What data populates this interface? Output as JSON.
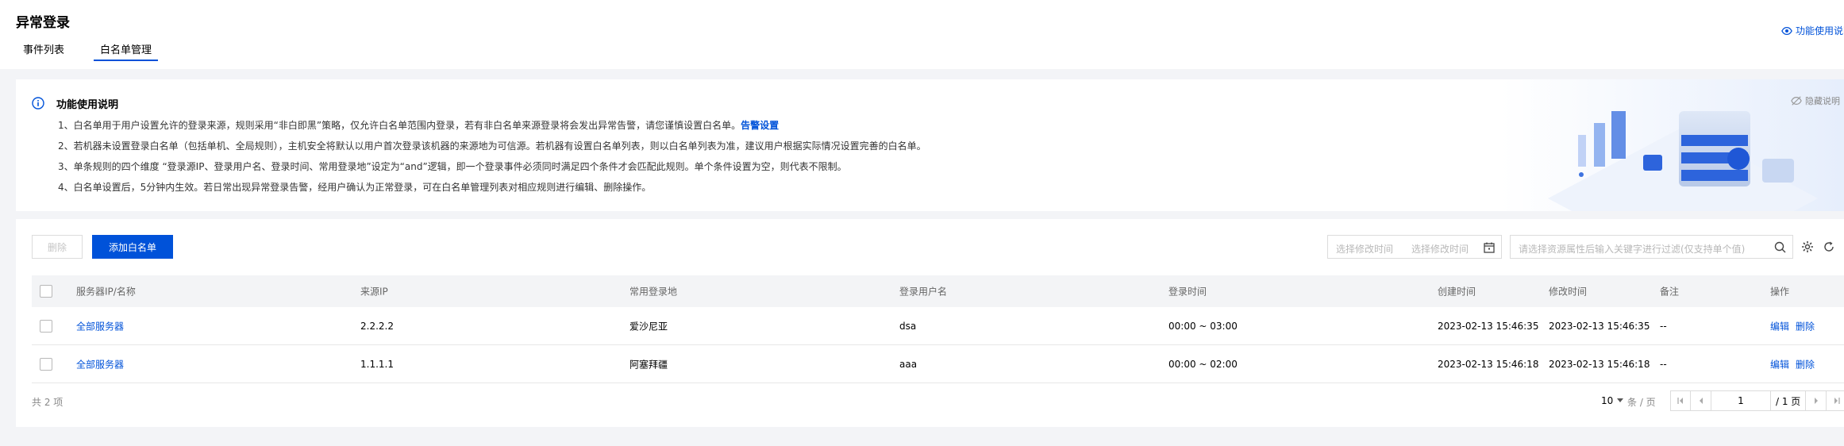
{
  "header": {
    "title": "异常登录",
    "tabs": [
      {
        "label": "事件列表",
        "active": false
      },
      {
        "label": "白名单管理",
        "active": true
      }
    ],
    "help_label": "功能使用说明"
  },
  "info": {
    "title": "功能使用说明",
    "lines": [
      "1、白名单用于用户设置允许的登录来源，规则采用“非白即黑”策略，仅允许白名单范围内登录，若有非白名单来源登录将会发出异常告警，请您谨慎设置白名单。",
      "2、若机器未设置登录白名单（包括单机、全局规则），主机安全将默认以用户首次登录该机器的来源地为可信源。若机器有设置白名单列表，则以白名单列表为准，建议用户根据实际情况设置完善的白名单。",
      "3、单条规则的四个维度 “登录源IP、登录用户名、登录时间、常用登录地”设定为“and”逻辑，即一个登录事件必须同时满足四个条件才会匹配此规则。单个条件设置为空，则代表不限制。",
      "4、白名单设置后，5分钟内生效。若日常出现异常登录告警，经用户确认为正常登录，可在白名单管理列表对相应规则进行编辑、删除操作。"
    ],
    "alert_link": "告警设置",
    "hide_label": "隐藏说明"
  },
  "toolbar": {
    "delete_label": "删除",
    "add_label": "添加白名单",
    "date_start_placeholder": "选择修改时间",
    "date_end_placeholder": "选择修改时间",
    "search_placeholder": "请选择资源属性后输入关键字进行过滤(仅支持单个值)"
  },
  "table": {
    "columns": [
      "服务器IP/名称",
      "来源IP",
      "常用登录地",
      "登录用户名",
      "登录时间",
      "创建时间",
      "修改时间",
      "备注",
      "操作"
    ],
    "rows": [
      {
        "server": "全部服务器",
        "source_ip": "2.2.2.2",
        "location": "爱沙尼亚",
        "username": "dsa",
        "login_time": "00:00 ~ 03:00",
        "created": "2023-02-13 15:46:35",
        "modified": "2023-02-13 15:46:35",
        "note": "--",
        "edit": "编辑",
        "delete": "删除"
      },
      {
        "server": "全部服务器",
        "source_ip": "1.1.1.1",
        "location": "阿塞拜疆",
        "username": "aaa",
        "login_time": "00:00 ~ 02:00",
        "created": "2023-02-13 15:46:18",
        "modified": "2023-02-13 15:46:18",
        "note": "--",
        "edit": "编辑",
        "delete": "删除"
      }
    ]
  },
  "pagination": {
    "total_label": "共 2 项",
    "page_size": "10",
    "per_page_label": "条 / 页",
    "current_page": "1",
    "total_pages_label": "/ 1 页"
  },
  "colors": {
    "primary": "#0052d9",
    "background": "#f3f4f7"
  }
}
